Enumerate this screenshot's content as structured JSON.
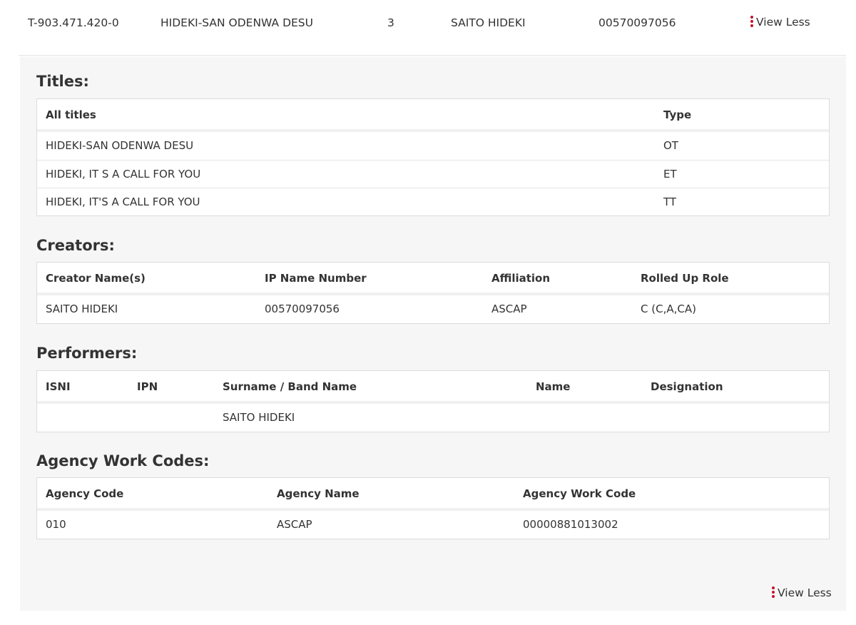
{
  "summary_row": {
    "iswc": "T-903.471.420-0",
    "title": "HIDEKI-SAN ODENWA DESU",
    "count": "3",
    "creator": "SAITO HIDEKI",
    "ip_name_number": "00570097056",
    "toggle_label": "View Less"
  },
  "titles": {
    "heading": "Titles:",
    "columns": [
      "All titles",
      "Type"
    ],
    "rows": [
      [
        "HIDEKI-SAN ODENWA DESU",
        "OT"
      ],
      [
        "HIDEKI, IT S A CALL FOR YOU",
        "ET"
      ],
      [
        "HIDEKI, IT'S A CALL FOR YOU",
        "TT"
      ]
    ]
  },
  "creators": {
    "heading": "Creators:",
    "columns": [
      "Creator Name(s)",
      "IP Name Number",
      "Affiliation",
      "Rolled Up Role"
    ],
    "rows": [
      [
        "SAITO HIDEKI",
        "00570097056",
        "ASCAP",
        "C (C,A,CA)"
      ]
    ]
  },
  "performers": {
    "heading": "Performers:",
    "columns": [
      "ISNI",
      "IPN",
      "Surname / Band Name",
      "Name",
      "Designation"
    ],
    "rows": [
      [
        "",
        "",
        "SAITO HIDEKI",
        "",
        ""
      ]
    ]
  },
  "agency_work_codes": {
    "heading": "Agency Work Codes:",
    "columns": [
      "Agency Code",
      "Agency Name",
      "Agency Work Code"
    ],
    "rows": [
      [
        "010",
        "ASCAP",
        "00000881013002"
      ]
    ]
  },
  "footer": {
    "toggle_label": "View Less"
  },
  "colors": {
    "accent": "#c8102e",
    "panel_bg": "#f6f6f6"
  }
}
